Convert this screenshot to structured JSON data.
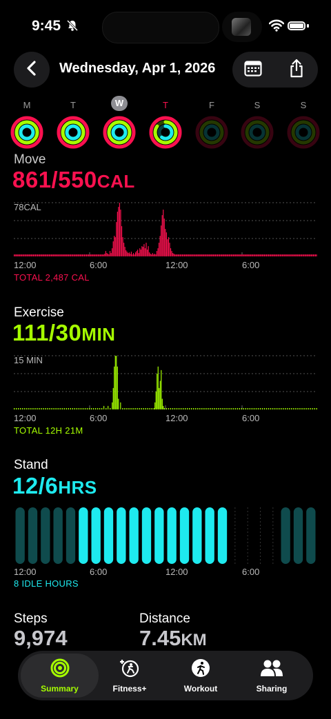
{
  "status_bar": {
    "time": "9:45"
  },
  "header": {
    "date_title": "Wednesday, Apr 1, 2026",
    "back_icon": "chevron-left-icon",
    "calendar_icon": "calendar-icon",
    "share_icon": "share-icon"
  },
  "week": {
    "days": [
      {
        "letter": "M",
        "move": 1,
        "exercise": 1,
        "stand": 1,
        "state": "past"
      },
      {
        "letter": "T",
        "move": 1,
        "exercise": 1,
        "stand": 1,
        "state": "past"
      },
      {
        "letter": "W",
        "move": 1,
        "exercise": 1,
        "stand": 1,
        "state": "selected"
      },
      {
        "letter": "T",
        "move": 1,
        "exercise": 0.85,
        "stand": 0.6,
        "state": "today"
      },
      {
        "letter": "F",
        "move": 0,
        "exercise": 0,
        "stand": 0,
        "state": "future"
      },
      {
        "letter": "S",
        "move": 0,
        "exercise": 0,
        "stand": 0,
        "state": "future"
      },
      {
        "letter": "S",
        "move": 0,
        "exercise": 0,
        "stand": 0,
        "state": "future"
      }
    ]
  },
  "move": {
    "label": "Move",
    "value": "861/550",
    "unit": "CAL",
    "color": "#fa114f",
    "max_label": "78CAL",
    "total": "TOTAL 2,487 CAL",
    "x_ticks": [
      "12:00",
      "6:00",
      "12:00",
      "6:00"
    ]
  },
  "exercise": {
    "label": "Exercise",
    "value": "111/30",
    "unit": "MIN",
    "color": "#a6ff00",
    "max_label": "15 MIN",
    "total": "TOTAL 12H 21M",
    "x_ticks": [
      "12:00",
      "6:00",
      "12:00",
      "6:00"
    ]
  },
  "stand": {
    "label": "Stand",
    "value": "12/6",
    "unit": "HRS",
    "color": "#1eeaef",
    "idle": "8 IDLE HOURS",
    "x_ticks": [
      "12:00",
      "6:00",
      "12:00",
      "6:00"
    ]
  },
  "steps": {
    "label": "Steps",
    "value": "9,974"
  },
  "distance": {
    "label": "Distance",
    "value": "7.45",
    "unit": "KM"
  },
  "tabs": [
    {
      "label": "Summary",
      "icon": "activity-rings-icon",
      "active": true
    },
    {
      "label": "Fitness+",
      "icon": "fitness-plus-icon",
      "active": false
    },
    {
      "label": "Workout",
      "icon": "running-figure-icon",
      "active": false
    },
    {
      "label": "Sharing",
      "icon": "people-icon",
      "active": false
    }
  ],
  "chart_data": [
    {
      "type": "bar",
      "title": "Move",
      "ylabel": "CAL",
      "ylim": [
        0,
        78
      ],
      "x": "5-minute intervals from 12:00 AM to 11:55 PM",
      "series": [
        {
          "name": "Move",
          "values": [
            3,
            3,
            3,
            3,
            3,
            3,
            3,
            3,
            3,
            3,
            3,
            3,
            3,
            3,
            3,
            3,
            3,
            3,
            3,
            3,
            3,
            3,
            3,
            3,
            3,
            3,
            3,
            3,
            3,
            3,
            3,
            3,
            3,
            3,
            3,
            3,
            3,
            3,
            3,
            3,
            3,
            3,
            3,
            3,
            3,
            3,
            3,
            3,
            3,
            3,
            3,
            3,
            3,
            3,
            3,
            3,
            3,
            3,
            3,
            3,
            3,
            3,
            3,
            3,
            3,
            3,
            3,
            3,
            3,
            3,
            3,
            3,
            3,
            3,
            3,
            3,
            3,
            3,
            3,
            3,
            3,
            3,
            3,
            3,
            3,
            4,
            8,
            5,
            4,
            3,
            8,
            5,
            12,
            22,
            30,
            28,
            50,
            65,
            72,
            78,
            68,
            44,
            28,
            20,
            14,
            9,
            7,
            5,
            6,
            4,
            7,
            3,
            5,
            3,
            6,
            8,
            10,
            5,
            12,
            10,
            15,
            14,
            18,
            12,
            20,
            10,
            15,
            6,
            4,
            3,
            5,
            3,
            4,
            3,
            8,
            12,
            20,
            30,
            45,
            60,
            68,
            55,
            40,
            35,
            25,
            28,
            20,
            12,
            8,
            5,
            4,
            3,
            3,
            3,
            3,
            3,
            3,
            3,
            3,
            3,
            3,
            3,
            3,
            3,
            3,
            3,
            3,
            3,
            3,
            3,
            3,
            3,
            3,
            3,
            3,
            3,
            3,
            3,
            3,
            3,
            3,
            3,
            3,
            3,
            3,
            3,
            3,
            3,
            3,
            3,
            3,
            3,
            3,
            3,
            3,
            3,
            3,
            3,
            3,
            3,
            3,
            3,
            3,
            3,
            3,
            3,
            3,
            3,
            3,
            3,
            3,
            3,
            3,
            3,
            3,
            3,
            3,
            3,
            3,
            3,
            3,
            3,
            3,
            3,
            3,
            3,
            3,
            3,
            3,
            3,
            3,
            3,
            3,
            3,
            3,
            3,
            3,
            3,
            3,
            3,
            3,
            3,
            3,
            3,
            3,
            3,
            3,
            3,
            3,
            3,
            3,
            3,
            3,
            3,
            3,
            3,
            3,
            3,
            3,
            3,
            3,
            3,
            3,
            3,
            3,
            3,
            3,
            3,
            3,
            3,
            3,
            3,
            3,
            3,
            3,
            3,
            3,
            3,
            3,
            3,
            3,
            3,
            3,
            3,
            3
          ]
        }
      ]
    },
    {
      "type": "bar",
      "title": "Exercise",
      "ylabel": "MIN",
      "ylim": [
        0,
        15
      ],
      "x": "5-minute intervals from 12:00 AM to 11:55 PM",
      "series": [
        {
          "name": "Exercise",
          "values": [
            0,
            0,
            0,
            0,
            0,
            0,
            0,
            0,
            0,
            0,
            0,
            0,
            0,
            0,
            0,
            0,
            0,
            0,
            0,
            0,
            0,
            0,
            0,
            0,
            0,
            0,
            0,
            0,
            0,
            0,
            0,
            0,
            0,
            0,
            0,
            0,
            0,
            0,
            0,
            0,
            0,
            0,
            0,
            0,
            0,
            0,
            0,
            0,
            0,
            0,
            0,
            0,
            0,
            0,
            0,
            0,
            0,
            0,
            0,
            0,
            0,
            0,
            0,
            0,
            0,
            0,
            0,
            0,
            0,
            0,
            0,
            0,
            0,
            0,
            0,
            0,
            0,
            0,
            0,
            0,
            0,
            0,
            0,
            0,
            0,
            0,
            1,
            0,
            0,
            0,
            1,
            0,
            0,
            0,
            2,
            6,
            12,
            15,
            15,
            12,
            3,
            0,
            2,
            0,
            0,
            0,
            0,
            0,
            0,
            0,
            0,
            0,
            0,
            0,
            0,
            0,
            0,
            0,
            0,
            0,
            0,
            0,
            0,
            0,
            0,
            0,
            0,
            0,
            0,
            0,
            0,
            0,
            0,
            0,
            0,
            2,
            5,
            10,
            12,
            6,
            8,
            11,
            3,
            1,
            0,
            0,
            0,
            0,
            0,
            0,
            0,
            0,
            0,
            0,
            0,
            0,
            0,
            0,
            0,
            0,
            0,
            0,
            0,
            0,
            0,
            0,
            0,
            0,
            0,
            0,
            0,
            0,
            0,
            0,
            0,
            0,
            0,
            0,
            0,
            0,
            0,
            0,
            0,
            0,
            0,
            0,
            0,
            0,
            0,
            0,
            0,
            0,
            0,
            0,
            0,
            0,
            0,
            0,
            0,
            0,
            0,
            0,
            0,
            0,
            0,
            0,
            0,
            0,
            0,
            0,
            0,
            0,
            0,
            0,
            0,
            0,
            0,
            0,
            0,
            0,
            0,
            0,
            0,
            0,
            0,
            0,
            0,
            0,
            0,
            0,
            0,
            0,
            0,
            0,
            0,
            0,
            0,
            0,
            0,
            0,
            0,
            0,
            0,
            0,
            0,
            0,
            0,
            0,
            0,
            0,
            0,
            0,
            0,
            0,
            0,
            0,
            0,
            0,
            0,
            0,
            0,
            0,
            0,
            0,
            0,
            0,
            0,
            0,
            0,
            0,
            0,
            0,
            0,
            0,
            0,
            0,
            0,
            0,
            0,
            0,
            0,
            0,
            0,
            0,
            0,
            0,
            0,
            0,
            0,
            0,
            0
          ]
        }
      ]
    },
    {
      "type": "bar",
      "title": "Stand",
      "categories": [
        "12AM",
        "1AM",
        "2AM",
        "3AM",
        "4AM",
        "5AM",
        "6AM",
        "7AM",
        "8AM",
        "9AM",
        "10AM",
        "11AM",
        "12PM",
        "1PM",
        "2PM",
        "3PM",
        "4PM",
        "5PM",
        "6PM",
        "7PM",
        "8PM",
        "9PM",
        "10PM",
        "11PM"
      ],
      "series": [
        {
          "name": "Stood",
          "values": [
            0,
            0,
            0,
            0,
            0,
            1,
            1,
            1,
            1,
            1,
            1,
            1,
            1,
            1,
            1,
            1,
            1,
            0,
            0,
            0,
            0,
            0,
            0,
            0
          ]
        },
        {
          "name": "Idle",
          "values": [
            1,
            1,
            1,
            1,
            1,
            0,
            0,
            0,
            0,
            0,
            0,
            0,
            0,
            0,
            0,
            0,
            0,
            0,
            0,
            0,
            0,
            1,
            1,
            1
          ]
        }
      ]
    }
  ]
}
